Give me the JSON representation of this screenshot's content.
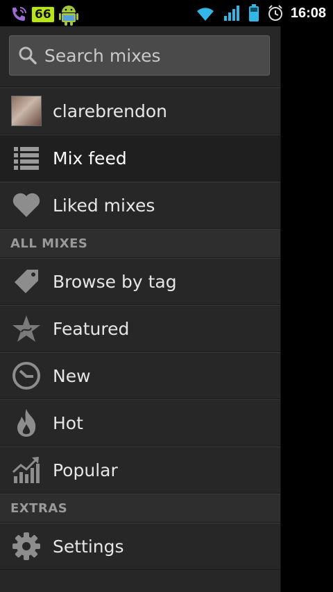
{
  "status_bar": {
    "badge": "66",
    "time": "16:08"
  },
  "search": {
    "placeholder": "Search mixes"
  },
  "user": {
    "name": "clarebrendon"
  },
  "nav": {
    "mix_feed": "Mix feed",
    "liked_mixes": "Liked mixes"
  },
  "sections": {
    "all_mixes": "ALL MIXES",
    "extras": "EXTRAS"
  },
  "all_mixes_items": {
    "browse_by_tag": "Browse by tag",
    "featured": "Featured",
    "new": "New",
    "hot": "Hot",
    "popular": "Popular"
  },
  "extras_items": {
    "settings": "Settings"
  }
}
